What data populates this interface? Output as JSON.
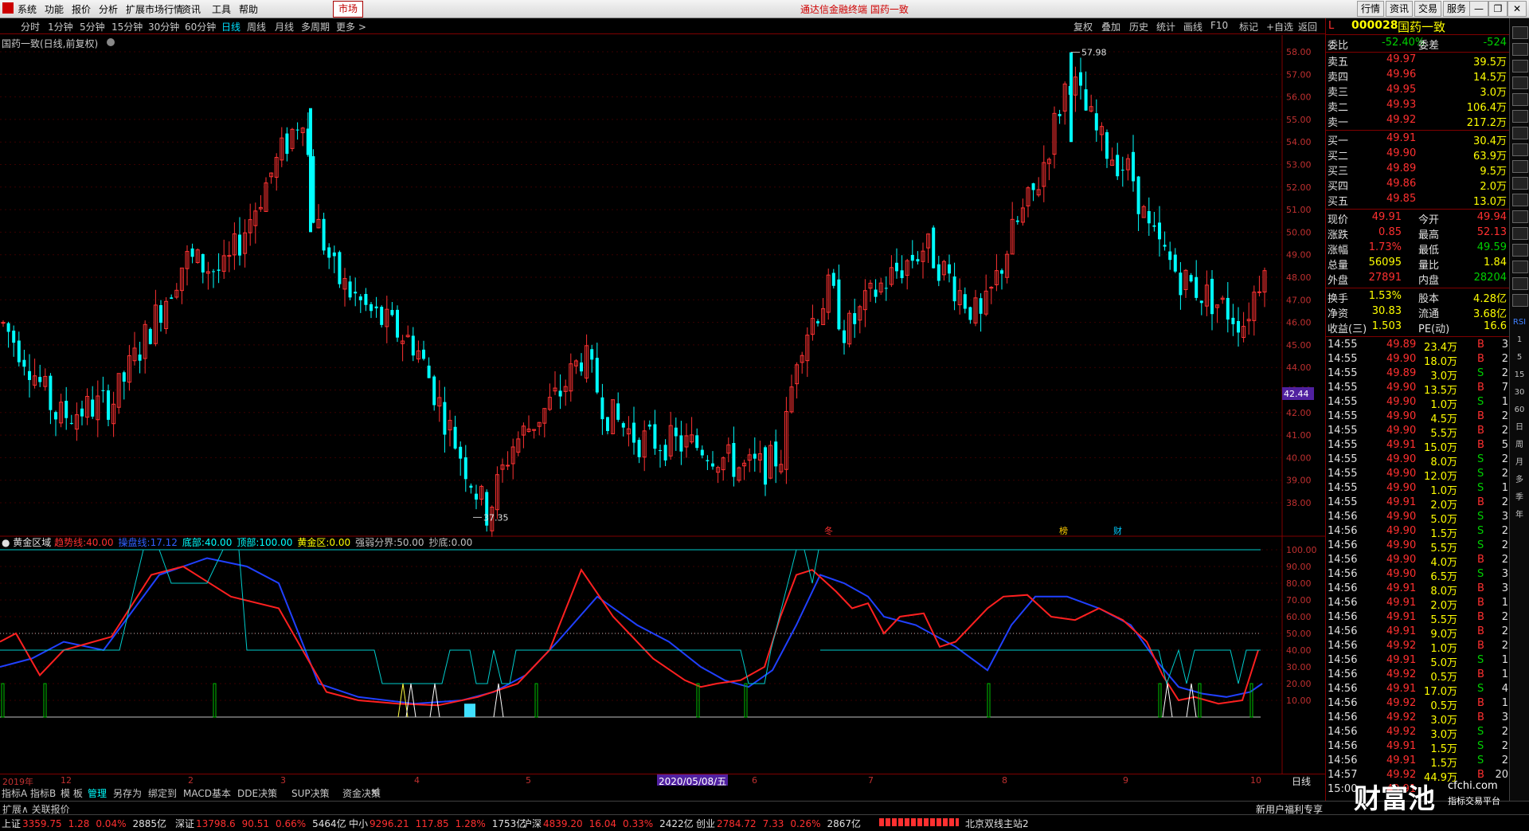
{
  "titlebar": {
    "menus": [
      "系统",
      "功能",
      "报价",
      "分析",
      "扩展市场行情",
      "资讯",
      "工具",
      "帮助"
    ],
    "market_tab": "市场",
    "center_title": "通达信金融终端  国药一致",
    "right_buttons": [
      "行情",
      "资讯",
      "交易",
      "服务"
    ]
  },
  "toolbar": {
    "periods": [
      "分时",
      "1分钟",
      "5分钟",
      "15分钟",
      "30分钟",
      "60分钟",
      "日线",
      "周线",
      "月线",
      "多周期",
      "更多 >"
    ],
    "active": "日线",
    "tools": [
      "复权",
      "叠加",
      "历史",
      "统计",
      "画线",
      "F10",
      "标记",
      "+自选",
      "返回"
    ]
  },
  "chart": {
    "title": "国药一致(日线,前复权)",
    "high_label": "57.98",
    "low_label": "37.35",
    "cursor_price": "42.44",
    "price_ticks": [
      "58.00",
      "57.00",
      "56.00",
      "55.00",
      "54.00",
      "53.00",
      "52.00",
      "51.00",
      "50.00",
      "49.00",
      "48.00",
      "47.00",
      "46.00",
      "45.00",
      "44.00",
      "43.00",
      "42.00",
      "41.00",
      "40.00",
      "39.00",
      "38.00"
    ],
    "markers": [
      "冬",
      "榜",
      "财"
    ]
  },
  "indicator": {
    "name": "黄金区域",
    "params": [
      {
        "label": "趋势线:",
        "value": "40.00",
        "color": "#ff3030"
      },
      {
        "label": "操盘线:",
        "value": "17.12",
        "color": "#3060ff"
      },
      {
        "label": "底部:",
        "value": "40.00",
        "color": "#00ffff"
      },
      {
        "label": "顶部:",
        "value": "100.00",
        "color": "#00ffff"
      },
      {
        "label": "黄金区:",
        "value": "0.00",
        "color": "#ffff00"
      },
      {
        "label": "强弱分界:",
        "value": "50.00",
        "color": "#c0c0c0"
      },
      {
        "label": "抄底:",
        "value": "0.00",
        "color": "#c0c0c0"
      }
    ],
    "ticks": [
      "100.00",
      "90.00",
      "80.00",
      "70.00",
      "60.00",
      "50.00",
      "40.00",
      "30.00",
      "20.00",
      "10.00"
    ]
  },
  "datebar": {
    "labels": [
      "2019年",
      "12",
      "2",
      "3",
      "4",
      "5",
      "6",
      "7",
      "8",
      "9",
      "10"
    ],
    "cursor_date": "2020/05/08/五",
    "period": "日线"
  },
  "bottom_tabs": [
    "指标A",
    "指标B",
    "模 板",
    "管理",
    "另存为",
    "绑定到",
    "MACD基本",
    "DDE决策",
    "SUP决策",
    "资金决策",
    "xl"
  ],
  "bottom_active": "管理",
  "statusbar": {
    "left": "扩展∧ 关联报价",
    "right": "新用户福利专享"
  },
  "indexbar": [
    {
      "name": "上证",
      "value": "3359.75",
      "chg": "1.28",
      "pct": "0.04%",
      "amt": "2885亿"
    },
    {
      "name": "深证",
      "value": "13798.6",
      "chg": "90.51",
      "pct": "0.66%",
      "amt": "5464亿"
    },
    {
      "name": "中小",
      "value": "9296.21",
      "chg": "117.85",
      "pct": "1.28%",
      "amt": "1753亿"
    },
    {
      "name": "沪深",
      "value": "4839.20",
      "chg": "16.04",
      "pct": "0.33%",
      "amt": "2422亿"
    },
    {
      "name": "创业",
      "value": "2784.72",
      "chg": "7.33",
      "pct": "0.26%",
      "amt": "2867亿"
    }
  ],
  "index_server": "北京双线主站2",
  "quote": {
    "code": "000028",
    "name": "国药一致",
    "webi": {
      "label": "委比",
      "pct": "-52.40%",
      "diff_label": "委差",
      "diff": "-524"
    },
    "asks": [
      {
        "label": "卖五",
        "price": "49.97",
        "vol": "39.5万"
      },
      {
        "label": "卖四",
        "price": "49.96",
        "vol": "14.5万"
      },
      {
        "label": "卖三",
        "price": "49.95",
        "vol": "3.0万"
      },
      {
        "label": "卖二",
        "price": "49.93",
        "vol": "106.4万"
      },
      {
        "label": "卖一",
        "price": "49.92",
        "vol": "217.2万"
      }
    ],
    "bids": [
      {
        "label": "买一",
        "price": "49.91",
        "vol": "30.4万"
      },
      {
        "label": "买二",
        "price": "49.90",
        "vol": "63.9万"
      },
      {
        "label": "买三",
        "price": "49.89",
        "vol": "9.5万"
      },
      {
        "label": "买四",
        "price": "49.86",
        "vol": "2.0万"
      },
      {
        "label": "买五",
        "price": "49.85",
        "vol": "13.0万"
      }
    ],
    "stats": [
      [
        "现价",
        "49.91",
        "今开",
        "49.94"
      ],
      [
        "涨跌",
        "0.85",
        "最高",
        "52.13"
      ],
      [
        "涨幅",
        "1.73%",
        "最低",
        "49.59"
      ],
      [
        "总量",
        "56095",
        "量比",
        "1.84"
      ],
      [
        "外盘",
        "27891",
        "内盘",
        "28204"
      ]
    ],
    "stats2": [
      [
        "换手",
        "1.53%",
        "股本",
        "4.28亿"
      ],
      [
        "净资",
        "30.83",
        "流通",
        "3.68亿"
      ],
      [
        "收益(三)",
        "1.503",
        "PE(动)",
        "16.6"
      ]
    ],
    "ticks": [
      [
        "14:55",
        "49.89",
        "23.4万",
        "B",
        "3"
      ],
      [
        "14:55",
        "49.90",
        "18.0万",
        "B",
        "2"
      ],
      [
        "14:55",
        "49.89",
        "3.0万",
        "S",
        "2"
      ],
      [
        "14:55",
        "49.90",
        "13.5万",
        "B",
        "7"
      ],
      [
        "14:55",
        "49.90",
        "1.0万",
        "S",
        "1"
      ],
      [
        "14:55",
        "49.90",
        "4.5万",
        "B",
        "2"
      ],
      [
        "14:55",
        "49.90",
        "5.5万",
        "B",
        "2"
      ],
      [
        "14:55",
        "49.91",
        "15.0万",
        "B",
        "5"
      ],
      [
        "14:55",
        "49.90",
        "8.0万",
        "S",
        "2"
      ],
      [
        "14:55",
        "49.90",
        "12.0万",
        "S",
        "2"
      ],
      [
        "14:55",
        "49.90",
        "1.0万",
        "S",
        "1"
      ],
      [
        "14:55",
        "49.91",
        "2.0万",
        "B",
        "2"
      ],
      [
        "14:56",
        "49.90",
        "5.0万",
        "S",
        "3"
      ],
      [
        "14:56",
        "49.90",
        "1.5万",
        "S",
        "2"
      ],
      [
        "14:56",
        "49.90",
        "5.5万",
        "S",
        "2"
      ],
      [
        "14:56",
        "49.90",
        "4.0万",
        "B",
        "2"
      ],
      [
        "14:56",
        "49.90",
        "6.5万",
        "S",
        "3"
      ],
      [
        "14:56",
        "49.91",
        "8.0万",
        "B",
        "3"
      ],
      [
        "14:56",
        "49.91",
        "2.0万",
        "B",
        "1"
      ],
      [
        "14:56",
        "49.91",
        "5.5万",
        "B",
        "2"
      ],
      [
        "14:56",
        "49.91",
        "9.0万",
        "B",
        "2"
      ],
      [
        "14:56",
        "49.92",
        "1.0万",
        "B",
        "2"
      ],
      [
        "14:56",
        "49.91",
        "5.0万",
        "S",
        "1"
      ],
      [
        "14:56",
        "49.92",
        "0.5万",
        "B",
        "1"
      ],
      [
        "14:56",
        "49.91",
        "17.0万",
        "S",
        "4"
      ],
      [
        "14:56",
        "49.92",
        "0.5万",
        "B",
        "1"
      ],
      [
        "14:56",
        "49.92",
        "3.0万",
        "B",
        "3"
      ],
      [
        "14:56",
        "49.92",
        "3.0万",
        "S",
        "2"
      ],
      [
        "14:56",
        "49.91",
        "1.5万",
        "S",
        "2"
      ],
      [
        "14:56",
        "49.91",
        "1.5万",
        "S",
        "2"
      ],
      [
        "14:57",
        "49.92",
        "44.9万",
        "B",
        "20"
      ],
      [
        "15:00",
        "49.91",
        "",
        "",
        ""
      ]
    ]
  },
  "watermark": {
    "big": "财富池",
    "small": "cfchi.com",
    "sub": "指标交易平台"
  },
  "right_icons": [
    "RSI",
    "1",
    "5",
    "15",
    "30",
    "60",
    "日",
    "周",
    "月",
    "多",
    "季",
    "年"
  ]
}
